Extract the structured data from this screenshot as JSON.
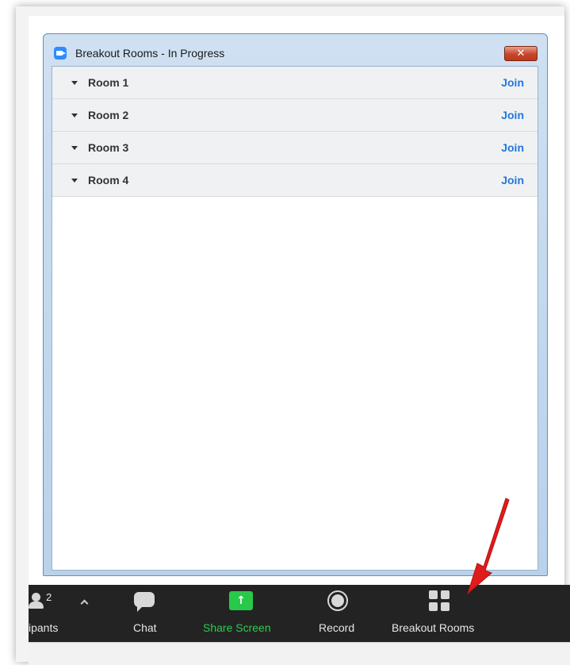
{
  "window": {
    "title": "Breakout Rooms - In Progress",
    "close_glyph": "✕"
  },
  "rooms": [
    {
      "name": "Room 1",
      "action": "Join"
    },
    {
      "name": "Room 2",
      "action": "Join"
    },
    {
      "name": "Room 3",
      "action": "Join"
    },
    {
      "name": "Room 4",
      "action": "Join"
    }
  ],
  "toolbar": {
    "participants_count": "2",
    "participants_label": "ipants",
    "chat_label": "Chat",
    "share_label": "Share Screen",
    "share_glyph": "↑",
    "record_label": "Record",
    "breakout_label": "Breakout Rooms"
  },
  "colors": {
    "accent": "#2477d9",
    "share_green": "#28c94a",
    "annotation_red": "#e01b1b",
    "toolbar_bg": "#232323"
  },
  "icons": [
    "zoom-camera-icon",
    "close-icon",
    "chevron-down-icon",
    "participants-icon",
    "caret-up-icon",
    "chat-icon",
    "share-screen-icon",
    "record-icon",
    "breakout-rooms-icon",
    "red-arrow-annotation"
  ]
}
